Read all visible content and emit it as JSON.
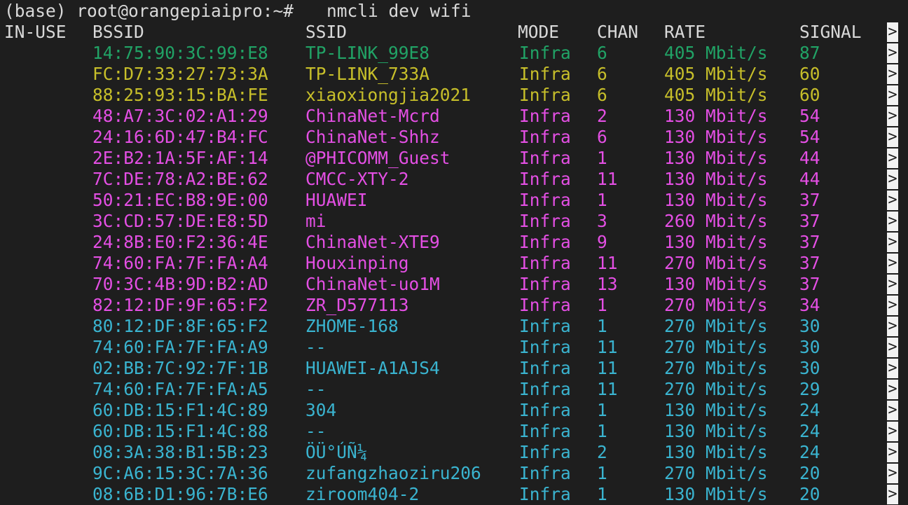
{
  "terminal": {
    "prompt": "(base) root@orangepiaipro:~# ",
    "command": "nmcli dev wifi",
    "truncation_marker": ">",
    "colors": {
      "background": "#1e1e1e",
      "text": "#e0e0e0",
      "green": "#21a366",
      "yellow": "#c7bf2a",
      "magenta": "#e44fe4",
      "cyan": "#3ab4d0"
    },
    "headers": [
      "IN-USE",
      "BSSID",
      "SSID",
      "MODE",
      "CHAN",
      "RATE",
      "SIGNAL"
    ],
    "rows": [
      {
        "in_use": "",
        "bssid": "14:75:90:3C:99:E8",
        "ssid": "TP-LINK_99E8",
        "mode": "Infra",
        "chan": "6",
        "rate": "405 Mbit/s",
        "signal": "87",
        "color": "#21a366"
      },
      {
        "in_use": "",
        "bssid": "FC:D7:33:27:73:3A",
        "ssid": "TP-LINK_733A",
        "mode": "Infra",
        "chan": "6",
        "rate": "405 Mbit/s",
        "signal": "60",
        "color": "#c7bf2a"
      },
      {
        "in_use": "",
        "bssid": "88:25:93:15:BA:FE",
        "ssid": "xiaoxiongjia2021",
        "mode": "Infra",
        "chan": "6",
        "rate": "405 Mbit/s",
        "signal": "60",
        "color": "#c7bf2a"
      },
      {
        "in_use": "",
        "bssid": "48:A7:3C:02:A1:29",
        "ssid": "ChinaNet-Mcrd",
        "mode": "Infra",
        "chan": "2",
        "rate": "130 Mbit/s",
        "signal": "54",
        "color": "#e44fe4"
      },
      {
        "in_use": "",
        "bssid": "24:16:6D:47:B4:FC",
        "ssid": "ChinaNet-Shhz",
        "mode": "Infra",
        "chan": "6",
        "rate": "130 Mbit/s",
        "signal": "54",
        "color": "#e44fe4"
      },
      {
        "in_use": "",
        "bssid": "2E:B2:1A:5F:AF:14",
        "ssid": "@PHICOMM_Guest",
        "mode": "Infra",
        "chan": "1",
        "rate": "130 Mbit/s",
        "signal": "44",
        "color": "#e44fe4"
      },
      {
        "in_use": "",
        "bssid": "7C:DE:78:A2:BE:62",
        "ssid": "CMCC-XTY-2",
        "mode": "Infra",
        "chan": "11",
        "rate": "130 Mbit/s",
        "signal": "44",
        "color": "#e44fe4"
      },
      {
        "in_use": "",
        "bssid": "50:21:EC:B8:9E:00",
        "ssid": "HUAWEI",
        "mode": "Infra",
        "chan": "1",
        "rate": "130 Mbit/s",
        "signal": "37",
        "color": "#e44fe4"
      },
      {
        "in_use": "",
        "bssid": "3C:CD:57:DE:E8:5D",
        "ssid": "mi",
        "mode": "Infra",
        "chan": "3",
        "rate": "260 Mbit/s",
        "signal": "37",
        "color": "#e44fe4"
      },
      {
        "in_use": "",
        "bssid": "24:8B:E0:F2:36:4E",
        "ssid": "ChinaNet-XTE9",
        "mode": "Infra",
        "chan": "9",
        "rate": "130 Mbit/s",
        "signal": "37",
        "color": "#e44fe4"
      },
      {
        "in_use": "",
        "bssid": "74:60:FA:7F:FA:A4",
        "ssid": "Houxinping",
        "mode": "Infra",
        "chan": "11",
        "rate": "270 Mbit/s",
        "signal": "37",
        "color": "#e44fe4"
      },
      {
        "in_use": "",
        "bssid": "70:3C:4B:9D:B2:AD",
        "ssid": "ChinaNet-uo1M",
        "mode": "Infra",
        "chan": "13",
        "rate": "130 Mbit/s",
        "signal": "37",
        "color": "#e44fe4"
      },
      {
        "in_use": "",
        "bssid": "82:12:DF:9F:65:F2",
        "ssid": "ZR_D577113",
        "mode": "Infra",
        "chan": "1",
        "rate": "270 Mbit/s",
        "signal": "34",
        "color": "#e44fe4"
      },
      {
        "in_use": "",
        "bssid": "80:12:DF:8F:65:F2",
        "ssid": "ZHOME-168",
        "mode": "Infra",
        "chan": "1",
        "rate": "270 Mbit/s",
        "signal": "30",
        "color": "#3ab4d0"
      },
      {
        "in_use": "",
        "bssid": "74:60:FA:7F:FA:A9",
        "ssid": "--",
        "mode": "Infra",
        "chan": "11",
        "rate": "270 Mbit/s",
        "signal": "30",
        "color": "#3ab4d0"
      },
      {
        "in_use": "",
        "bssid": "02:BB:7C:92:7F:1B",
        "ssid": "HUAWEI-A1AJS4",
        "mode": "Infra",
        "chan": "11",
        "rate": "270 Mbit/s",
        "signal": "30",
        "color": "#3ab4d0"
      },
      {
        "in_use": "",
        "bssid": "74:60:FA:7F:FA:A5",
        "ssid": "--",
        "mode": "Infra",
        "chan": "11",
        "rate": "270 Mbit/s",
        "signal": "29",
        "color": "#3ab4d0"
      },
      {
        "in_use": "",
        "bssid": "60:DB:15:F1:4C:89",
        "ssid": "304",
        "mode": "Infra",
        "chan": "1",
        "rate": "130 Mbit/s",
        "signal": "24",
        "color": "#3ab4d0"
      },
      {
        "in_use": "",
        "bssid": "60:DB:15:F1:4C:88",
        "ssid": "--",
        "mode": "Infra",
        "chan": "1",
        "rate": "130 Mbit/s",
        "signal": "24",
        "color": "#3ab4d0"
      },
      {
        "in_use": "",
        "bssid": "08:3A:38:B1:5B:23",
        "ssid": "ÖÜ°ÚÑ¼",
        "mode": "Infra",
        "chan": "2",
        "rate": "130 Mbit/s",
        "signal": "24",
        "color": "#3ab4d0"
      },
      {
        "in_use": "",
        "bssid": "9C:A6:15:3C:7A:36",
        "ssid": "zufangzhaoziru206",
        "mode": "Infra",
        "chan": "1",
        "rate": "270 Mbit/s",
        "signal": "20",
        "color": "#3ab4d0"
      },
      {
        "in_use": "",
        "bssid": "08:6B:D1:96:7B:E6",
        "ssid": "ziroom404-2",
        "mode": "Infra",
        "chan": "1",
        "rate": "130 Mbit/s",
        "signal": "20",
        "color": "#3ab4d0"
      }
    ]
  }
}
